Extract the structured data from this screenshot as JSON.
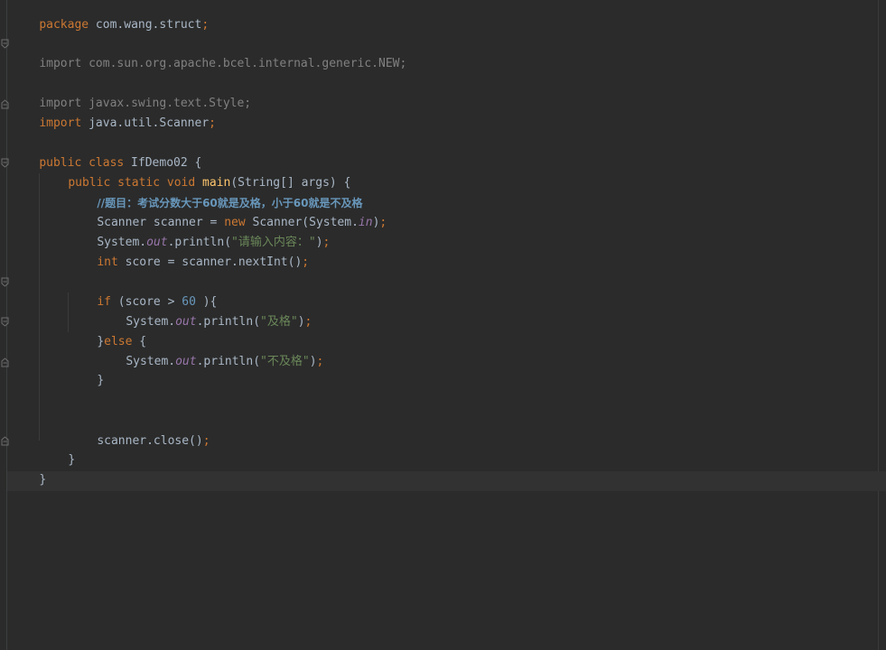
{
  "code": {
    "l1": {
      "kw": "package",
      "rest": " com.wang.struct",
      "semi": ";"
    },
    "l3": {
      "kw": "import",
      "rest": " com.sun.org.apache.bcel.internal.generic.NEW;"
    },
    "l5": {
      "kw": "import",
      "rest": " javax.swing.text.Style;"
    },
    "l6": {
      "kw": "import",
      "rest": " java.util.Scanner",
      "semi": ";"
    },
    "l8": {
      "kw": "public class",
      "rest": " IfDemo02 {"
    },
    "l9": {
      "kw": "public static void",
      "fn": "main",
      "rest": "(String[] args) {"
    },
    "l10": {
      "comment": "//题目：考试分数大于60就是及格，小于60就是不及格"
    },
    "l11": {
      "a": "Scanner scanner = ",
      "kw": "new",
      "b": " Scanner(System.",
      "st": "in",
      "c": ")",
      "semi": ";"
    },
    "l12": {
      "a": "System.",
      "st": "out",
      "b": ".println(",
      "str": "\"请输入内容：\"",
      "c": ")",
      "semi": ";"
    },
    "l13": {
      "kw": "int",
      "a": " score = scanner.nextInt()",
      "semi": ";"
    },
    "l15": {
      "kw": "if",
      "a": " (score > ",
      "num": "60",
      "b": " ){"
    },
    "l16": {
      "a": "System.",
      "st": "out",
      "b": ".println(",
      "str": "\"及格\"",
      "c": ")",
      "semi": ";"
    },
    "l17": {
      "a": "}",
      "kw": "else",
      "b": " {"
    },
    "l18": {
      "a": "System.",
      "st": "out",
      "b": ".println(",
      "str": "\"不及格\"",
      "c": ")",
      "semi": ";"
    },
    "l19": {
      "a": "}"
    },
    "l22": {
      "a": "scanner.close()",
      "semi": ";"
    },
    "l23": {
      "a": "}"
    },
    "l24": {
      "a": "}"
    }
  },
  "colors": {
    "background": "#2b2b2b",
    "keyword": "#cc7832",
    "text": "#a9b7c6",
    "string": "#6a8759",
    "number": "#6897bb",
    "static_field": "#9876aa",
    "function": "#ffc66d",
    "unused_import": "#808080"
  }
}
